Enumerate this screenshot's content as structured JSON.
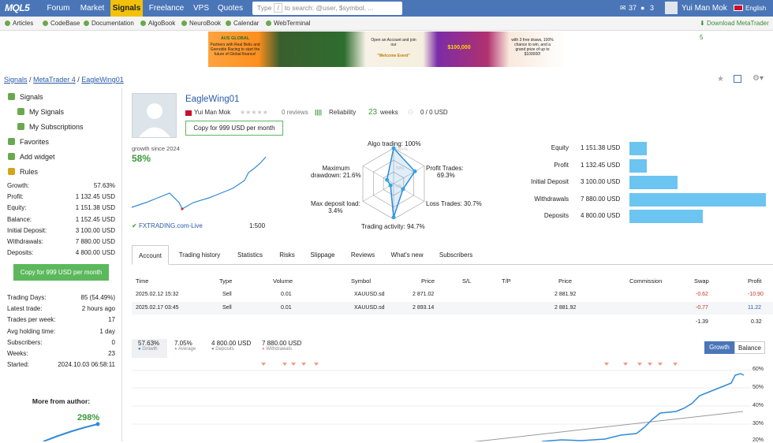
{
  "topbar": {
    "logo": "MQL5",
    "nav": [
      "Forum",
      "Market",
      "Signals",
      "Freelance",
      "VPS",
      "Quotes"
    ],
    "search_type": "Type",
    "search_key": "/",
    "search_rest": "to search: @user, $symbol, ...",
    "count1": "37",
    "count2": "3",
    "username": "Yui Man Mok",
    "language": "English"
  },
  "subbar": {
    "items": [
      "Articles",
      "CodeBase",
      "Documentation",
      "AlgoBook",
      "NeuroBook",
      "Calendar",
      "WebTerminal"
    ],
    "download": "Download MetaTrader 5"
  },
  "banner": {
    "brand": "AUS GLOBAL",
    "partner_text": "Partners with Real Betis and Grenoble Racing to start the future of Global finance!",
    "offer": "Open an Account and join our",
    "event": "\"Welcome Event\"",
    "prize": "$100,000",
    "draw": "with 3 free draws, 100% chance to win, and a grand prize of up to $100000!"
  },
  "breadcrumb": {
    "a": "Signals",
    "b": "MetaTrader 4",
    "c": "EagleWing01"
  },
  "sidebar": {
    "menu": [
      "Signals",
      "My Signals",
      "My Subscriptions",
      "Favorites",
      "Add widget",
      "Rules"
    ],
    "stats1": [
      [
        "Growth:",
        "57.63%"
      ],
      [
        "Profit:",
        "1 132.45 USD"
      ],
      [
        "Equity:",
        "1 151.38 USD"
      ],
      [
        "Balance:",
        "1 152.45 USD"
      ],
      [
        "Initial Deposit:",
        "3 100.00 USD"
      ],
      [
        "Withdrawals:",
        "7 880.00 USD"
      ],
      [
        "Deposits:",
        "4 800.00 USD"
      ]
    ],
    "copy_btn": "Copy for 999 USD per month",
    "stats2": [
      [
        "Trading Days:",
        "85 (54.49%)"
      ],
      [
        "Latest trade:",
        "2 hours ago"
      ],
      [
        "Trades per week:",
        "17"
      ],
      [
        "Avg holding time:",
        "1 day"
      ],
      [
        "Subscribers:",
        "0"
      ],
      [
        "Weeks:",
        "23"
      ],
      [
        "Started:",
        "2024.10.03 06:58:11"
      ]
    ],
    "more_title": "More from author:",
    "more_value": "298%"
  },
  "signal": {
    "title": "EagleWing01",
    "author": "Yui Man Mok",
    "reviews": "0 reviews",
    "reliability": "Reliability",
    "weeks": "23",
    "weeks_label": "weeks",
    "subs": "0 / 0 USD",
    "copy_btn": "Copy for 999 USD per month",
    "growth_label": "growth since 2024",
    "growth": "58%",
    "broker": "FXTRADING.com-Live",
    "leverage": "1:500"
  },
  "radar": {
    "algo": "Algo trading: 100%",
    "profit_a": "Profit Trades:",
    "profit_b": "69.3%",
    "loss": "Loss Trades: 30.7%",
    "activity": "Trading activity: 94.7%",
    "maxload_a": "Max deposit load:",
    "maxload_b": "3.4%",
    "drawdown_a": "Maximum",
    "drawdown_b": "drawdown: 21.6%",
    "ring100": "100+%",
    "ring50": "50%",
    "ring0": "0%"
  },
  "bars": [
    {
      "label": "Equity",
      "value": "1 151.38 USD",
      "frac": 0.13
    },
    {
      "label": "Profit",
      "value": "1 132.45 USD",
      "frac": 0.13
    },
    {
      "label": "Initial Deposit",
      "value": "3 100.00 USD",
      "frac": 0.35
    },
    {
      "label": "Withdrawals",
      "value": "7 880.00 USD",
      "frac": 1.0
    },
    {
      "label": "Deposits",
      "value": "4 800.00 USD",
      "frac": 0.54
    }
  ],
  "tabs": [
    "Account",
    "Trading history",
    "Statistics",
    "Risks",
    "Slippage",
    "Reviews",
    "What's new",
    "Subscribers"
  ],
  "table": {
    "headers": [
      "Time",
      "Type",
      "Volume",
      "Symbol",
      "Price",
      "S/L",
      "T/P",
      "Price",
      "Commission",
      "Swap",
      "Profit"
    ],
    "rows": [
      [
        "2025.02.12 15:32",
        "Sell",
        "0.01",
        "XAUUSD.sd",
        "2 871.02",
        "",
        "",
        "2 881.92",
        "",
        "-0.62",
        "-10.90"
      ],
      [
        "2025.02.17 03:45",
        "Sell",
        "0.01",
        "XAUUSD.sd",
        "2 893.14",
        "",
        "",
        "2 881.92",
        "",
        "-0.77",
        "11.22"
      ]
    ],
    "total_swap": "-1.39",
    "total_profit": "0.32"
  },
  "chart": {
    "growth_v": "57.63%",
    "growth_l": "Growth",
    "avg_v": "7.05%",
    "avg_l": "Average",
    "dep_v": "4 800.00 USD",
    "dep_l": "Deposits",
    "wd_v": "7 880.00 USD",
    "wd_l": "Withdrawals",
    "toggle_a": "Growth",
    "toggle_b": "Balance",
    "yticks": [
      "60%",
      "50%",
      "40%",
      "30%",
      "20%"
    ]
  },
  "colors": {
    "accent": "#4a76b8",
    "signals_tab": "#f2c10b",
    "green": "#5cb85c",
    "bar": "#6cc4f1",
    "line": "#2f8ad6"
  }
}
